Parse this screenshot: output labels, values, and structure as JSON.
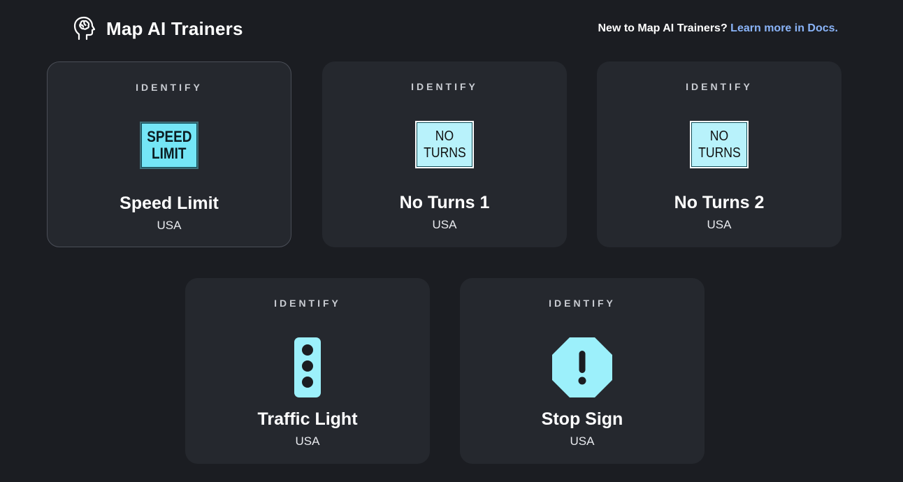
{
  "header": {
    "title": "Map AI Trainers",
    "prompt": "New to Map AI Trainers?",
    "link_text": "Learn more in Docs.",
    "logo_icon": "head-with-brain-icon"
  },
  "colors": {
    "background": "#1b1d22",
    "card": "#25282e",
    "accent": "#8ab4f8",
    "sign": "#7fe8f7"
  },
  "cards": [
    {
      "kicker": "IDENTIFY",
      "title": "Speed Limit",
      "subtitle": "USA",
      "icon": "speed-limit-sign-icon",
      "sign_lines": [
        "SPEED",
        "LIMIT"
      ],
      "active": true
    },
    {
      "kicker": "IDENTIFY",
      "title": "No Turns 1",
      "subtitle": "USA",
      "icon": "no-turns-sign-icon",
      "sign_lines": [
        "NO",
        "TURNS"
      ]
    },
    {
      "kicker": "IDENTIFY",
      "title": "No Turns 2",
      "subtitle": "USA",
      "icon": "no-turns-sign-icon",
      "sign_lines": [
        "NO",
        "TURNS"
      ]
    },
    {
      "kicker": "IDENTIFY",
      "title": "Traffic Light",
      "subtitle": "USA",
      "icon": "traffic-light-icon"
    },
    {
      "kicker": "IDENTIFY",
      "title": "Stop Sign",
      "subtitle": "USA",
      "icon": "stop-sign-icon"
    }
  ]
}
